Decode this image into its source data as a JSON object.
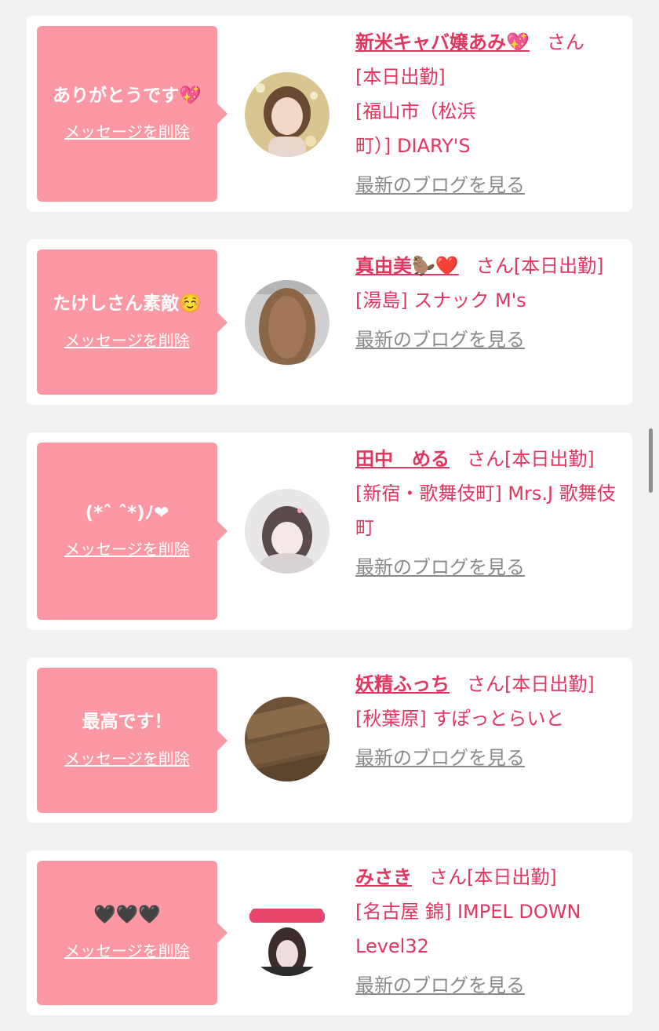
{
  "entries": [
    {
      "message": "ありがとうです💖",
      "delete_label": "メッセージを削除",
      "name": "新米キャバ嬢あみ💖",
      "honorific": "さん",
      "status": "[本日出勤]",
      "location": "[福山市（松浜町）] DIARY'S",
      "blog_label": "最新のブログを見る",
      "avatar_icon": "profile-photo-icon"
    },
    {
      "message": "たけしさん素敵☺️",
      "delete_label": "メッセージを削除",
      "name": "真由美🦫❤️",
      "honorific": "さん",
      "status": "[本日出勤]",
      "location": "[湯島] スナック M's",
      "blog_label": "最新のブログを見る",
      "avatar_icon": "profile-photo-icon"
    },
    {
      "message": "(*ˆ ˆ*)ﾉ❤",
      "delete_label": "メッセージを削除",
      "name": "田中　める",
      "honorific": "さん",
      "status": "[本日出勤]",
      "location": "[新宿・歌舞伎町] Mrs.J 歌舞伎町",
      "blog_label": "最新のブログを見る",
      "avatar_icon": "profile-photo-icon"
    },
    {
      "message": "最高です！",
      "delete_label": "メッセージを削除",
      "name": "妖精ふっち",
      "honorific": "さん",
      "status": "[本日出勤]",
      "location": "[秋葉原] すぽっとらいと",
      "blog_label": "最新のブログを見る",
      "avatar_icon": "profile-photo-icon"
    },
    {
      "message": "🖤🖤🖤",
      "delete_label": "メッセージを削除",
      "name": "みさき",
      "honorific": "さん",
      "status": "[本日出勤]",
      "location": "[名古屋 錦] IMPEL DOWN Level32",
      "blog_label": "最新のブログを見る",
      "avatar_icon": "profile-photo-icon"
    }
  ],
  "colors": {
    "accent": "#e2365f",
    "bubble": "#fc98a4",
    "link_gray": "#8a8a8a",
    "background": "#f2f2f2"
  }
}
